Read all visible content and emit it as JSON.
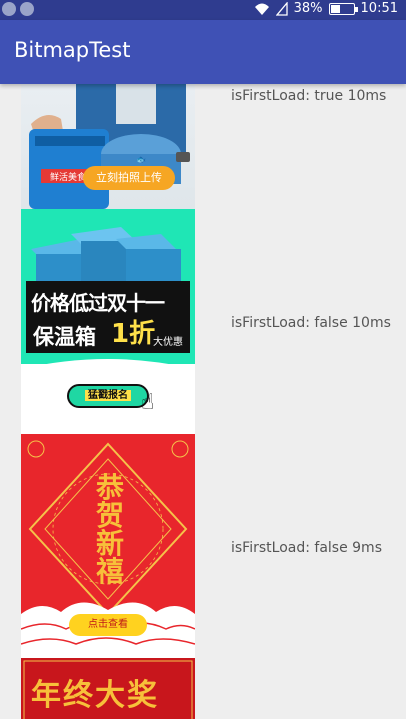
{
  "status_bar": {
    "battery_percent": "38%",
    "battery_level": 0.38,
    "time": "10:51",
    "icons": [
      "notification-icon",
      "notification-icon",
      "wifi-icon",
      "signal-icon",
      "battery-icon"
    ]
  },
  "app_bar": {
    "title": "BitmapTest",
    "color": "#3f51b5"
  },
  "list": {
    "items": [
      {
        "caption": "isFirstLoad: true  10ms",
        "image": {
          "button_label": "立刻拍照上传",
          "logo_text": "鲜活美食"
        }
      },
      {
        "caption": "isFirstLoad: false  10ms",
        "image": {
          "headline_1": "价格低过双十一",
          "headline_2": "保温箱",
          "headline_3": "1折",
          "headline_4": "大优惠",
          "button_label": "猛戳报名"
        }
      },
      {
        "caption": "isFirstLoad: false  9ms",
        "image": {
          "chars": "恭贺新禧",
          "button_label": "点击查看"
        }
      },
      {
        "caption": "",
        "image": {
          "chars": "年终大奖"
        }
      }
    ]
  }
}
